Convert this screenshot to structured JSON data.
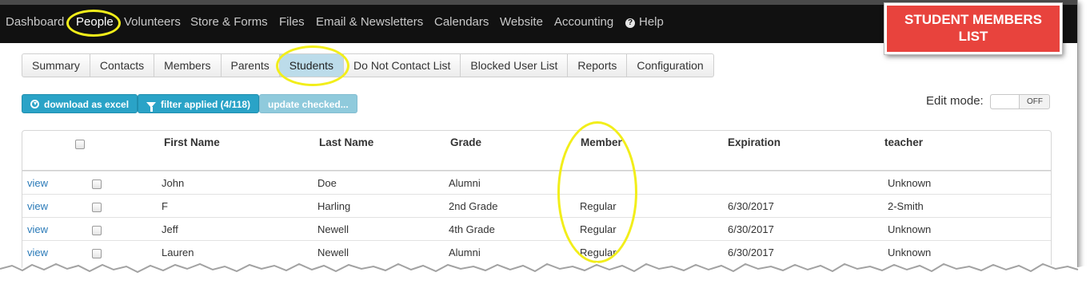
{
  "nav": {
    "items": [
      "Dashboard",
      "People",
      "Volunteers",
      "Store & Forms",
      "Files",
      "Email & Newsletters",
      "Calendars",
      "Website",
      "Accounting"
    ],
    "help": "Help",
    "active": "People"
  },
  "callout": {
    "line1": "STUDENT MEMBERS",
    "line2": "LIST",
    "color": "#e8433d"
  },
  "tabs": {
    "items": [
      "Summary",
      "Contacts",
      "Members",
      "Parents",
      "Students",
      "Do Not Contact List",
      "Blocked User List",
      "Reports",
      "Configuration"
    ],
    "active": "Students"
  },
  "actions": {
    "download": "download as excel",
    "filter": "filter applied (4/118)",
    "update": "update checked..."
  },
  "edit_mode": {
    "label": "Edit mode:",
    "state": "OFF"
  },
  "table": {
    "headers": [
      "First Name",
      "Last Name",
      "Grade",
      "Member",
      "Expiration",
      "teacher"
    ],
    "view_label": "view",
    "rows": [
      {
        "first": "John",
        "last": "Doe",
        "grade": "Alumni",
        "member": "",
        "expiration": "",
        "teacher": "Unknown"
      },
      {
        "first": "F",
        "last": "Harling",
        "grade": "2nd Grade",
        "member": "Regular",
        "expiration": "6/30/2017",
        "teacher": "2-Smith"
      },
      {
        "first": "Jeff",
        "last": "Newell",
        "grade": "4th Grade",
        "member": "Regular",
        "expiration": "6/30/2017",
        "teacher": "Unknown"
      },
      {
        "first": "Lauren",
        "last": "Newell",
        "grade": "Alumni",
        "member": "Regular",
        "expiration": "6/30/2017",
        "teacher": "Unknown"
      }
    ]
  },
  "colors": {
    "nav_bg": "#111111",
    "accent": "#2aa3c7",
    "highlight": "#f2ee1a",
    "link": "#2a7ab8"
  }
}
